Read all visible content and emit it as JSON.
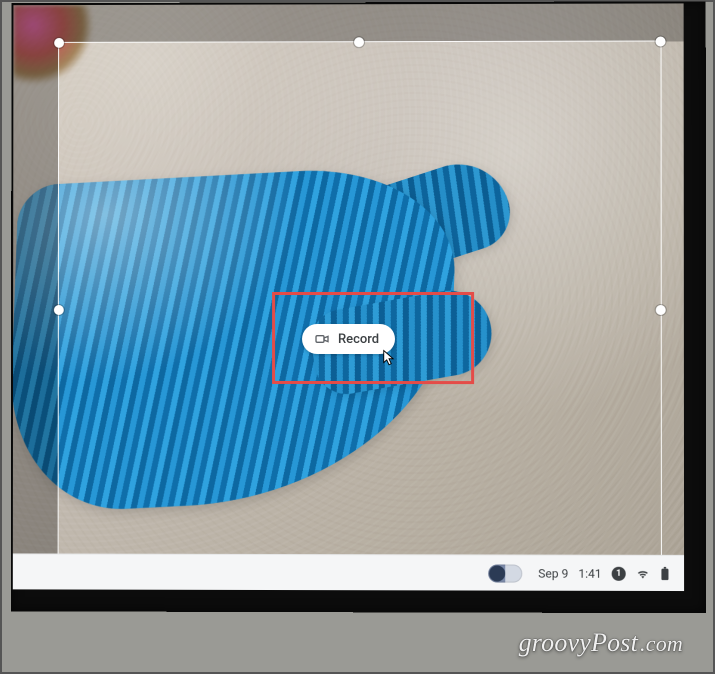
{
  "record_button": {
    "label": "Record"
  },
  "taskbar": {
    "date": "Sep 9",
    "time": "1:41",
    "notification_count": "1"
  },
  "watermark": {
    "brand": "groovy",
    "suffix": "Post",
    "tld": ".com"
  },
  "highlight": {
    "color": "#e44c48"
  }
}
